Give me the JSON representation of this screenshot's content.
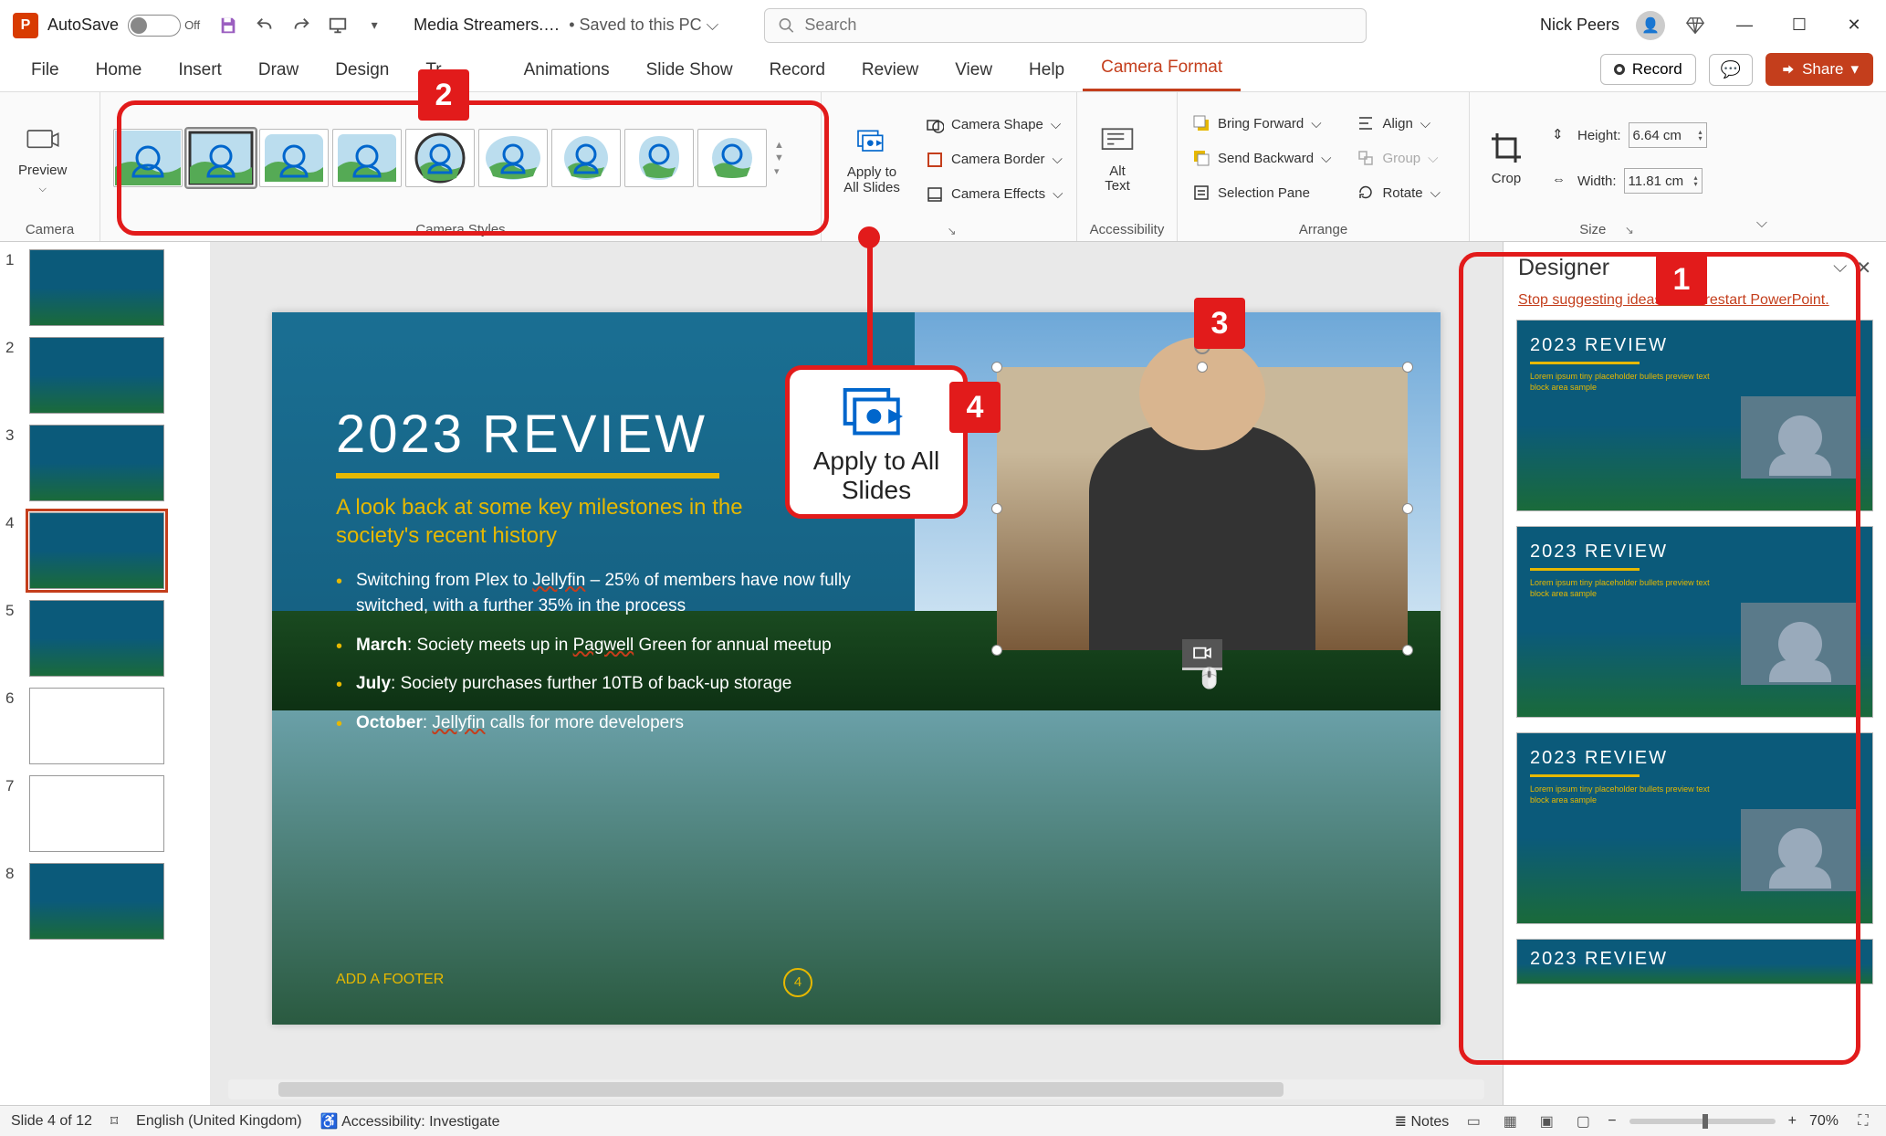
{
  "titlebar": {
    "autosave_label": "AutoSave",
    "autosave_state": "Off",
    "filename": "Media Streamers.…",
    "saved_location": "Saved to this PC",
    "search_placeholder": "Search",
    "username": "Nick Peers"
  },
  "tabs": {
    "items": [
      "File",
      "Home",
      "Insert",
      "Draw",
      "Design",
      "Tr",
      "Animations",
      "Slide Show",
      "Record",
      "Review",
      "View",
      "Help",
      "Camera Format"
    ],
    "active": "Camera Format",
    "record": "Record",
    "share": "Share"
  },
  "ribbon": {
    "camera_group": "Camera",
    "preview": "Preview",
    "camera_styles_group": "Camera Styles",
    "apply_all": "Apply to All Slides",
    "camera_shape": "Camera Shape",
    "camera_border": "Camera Border",
    "camera_effects": "Camera Effects",
    "accessibility_group": "Accessibility",
    "alt_text": "Alt Text",
    "arrange_group": "Arrange",
    "bring_forward": "Bring Forward",
    "send_backward": "Send Backward",
    "selection_pane": "Selection Pane",
    "align": "Align",
    "group": "Group",
    "rotate": "Rotate",
    "size_group": "Size",
    "crop": "Crop",
    "height_label": "Height:",
    "height_value": "6.64 cm",
    "width_label": "Width:",
    "width_value": "11.81 cm"
  },
  "thumbnails": {
    "count": 8,
    "selected": 4
  },
  "slide": {
    "title": "2023 REVIEW",
    "subtitle": "A look back at some key milestones in the society's recent history",
    "bullets": [
      {
        "pre": "Switching from Plex to ",
        "u": "Jellyfin",
        "post": " – 25% of members have now fully switched, with a further 35% in the process"
      },
      {
        "b": "March",
        "post": ": Society meets up in ",
        "u": "Pagwell",
        "post2": " Green for annual meetup"
      },
      {
        "b": "July",
        "post": ": Society purchases further 10TB of back-up storage"
      },
      {
        "b": "October",
        "post": ": ",
        "u": "Jellyfin",
        "post2": " calls for more developers"
      }
    ],
    "footer_placeholder": "ADD A FOOTER",
    "page_number": "4"
  },
  "popup": {
    "label": "Apply to All Slides"
  },
  "designer": {
    "title": "Designer",
    "stop_link": "Stop suggesting ideas until I restart PowerPoint.",
    "item_title": "2023 REVIEW"
  },
  "status": {
    "slide": "Slide 4 of 12",
    "language": "English (United Kingdom)",
    "accessibility": "Accessibility: Investigate",
    "notes": "Notes",
    "zoom": "70%"
  },
  "callouts": [
    "1",
    "2",
    "3",
    "4"
  ]
}
